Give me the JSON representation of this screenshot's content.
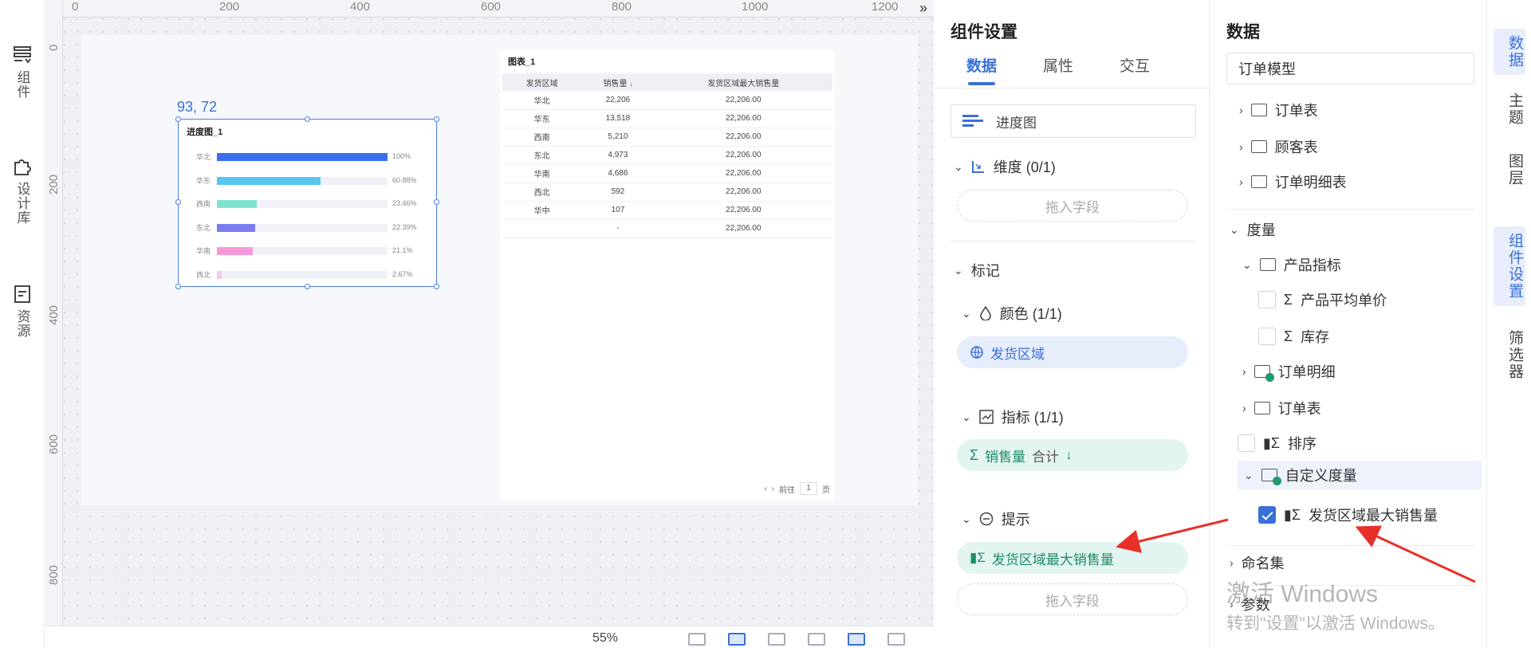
{
  "left_rail": {
    "items": [
      {
        "label": "组件"
      },
      {
        "label": "设计库"
      },
      {
        "label": "资源"
      }
    ]
  },
  "canvas": {
    "ruler_top_ticks": [
      "0",
      "200",
      "400",
      "600",
      "800",
      "1000",
      "1200"
    ],
    "ruler_left_ticks": [
      "0",
      "200",
      "400",
      "600",
      "800"
    ],
    "widget_coords": "93, 72",
    "zoom": "55%",
    "progress_widget": {
      "title": "进度图_1",
      "rows": [
        {
          "category": "华北",
          "percent_label": "100%",
          "fraction": 1.0,
          "color": "#3a6ff0"
        },
        {
          "category": "华东",
          "percent_label": "60.88%",
          "fraction": 0.6088,
          "color": "#58c6ef"
        },
        {
          "category": "西南",
          "percent_label": "23.46%",
          "fraction": 0.2346,
          "color": "#7de3cf"
        },
        {
          "category": "东北",
          "percent_label": "22.39%",
          "fraction": 0.2239,
          "color": "#7b7cf0"
        },
        {
          "category": "华南",
          "percent_label": "21.1%",
          "fraction": 0.211,
          "color": "#f59ad8"
        },
        {
          "category": "西北",
          "percent_label": "2.67%",
          "fraction": 0.0267,
          "color": "#f7c9e8"
        }
      ]
    },
    "table_widget": {
      "title": "图表_1",
      "columns": [
        "发货区域",
        "销售量",
        "发货区域最大销售量"
      ],
      "sort_marker": "↓",
      "rows": [
        [
          "华北",
          "22,206",
          "22,206.00"
        ],
        [
          "华东",
          "13,518",
          "22,206.00"
        ],
        [
          "西南",
          "5,210",
          "22,206.00"
        ],
        [
          "东北",
          "4,973",
          "22,206.00"
        ],
        [
          "华南",
          "4,686",
          "22,206.00"
        ],
        [
          "西北",
          "592",
          "22,206.00"
        ],
        [
          "华中",
          "107",
          "22,206.00"
        ],
        [
          "",
          "-",
          "22,206.00"
        ]
      ],
      "pager": {
        "prev": "‹",
        "next": "›",
        "goto_label": "前往",
        "page": "1",
        "page_suffix": "页"
      }
    }
  },
  "settings": {
    "title": "组件设置",
    "tabs": [
      {
        "label": "数据",
        "active": true
      },
      {
        "label": "属性",
        "active": false
      },
      {
        "label": "交互",
        "active": false
      }
    ],
    "chart_type": "进度图",
    "dimension": {
      "label": "维度 (0/1)",
      "drop_placeholder": "拖入字段"
    },
    "marks": {
      "label": "标记"
    },
    "color": {
      "label": "颜色 (1/1)",
      "field": "发货区域"
    },
    "metric": {
      "label": "指标 (1/1)",
      "field": "销售量",
      "agg": "合计",
      "sort": "↓"
    },
    "tooltip": {
      "label": "提示",
      "field": "发货区域最大销售量",
      "drop_placeholder": "拖入字段"
    }
  },
  "data_panel": {
    "title": "数据",
    "model": "订单模型",
    "tables": [
      "订单表",
      "顾客表",
      "订单明细表"
    ],
    "measure_label": "度量",
    "product_folder": "产品指标",
    "product_items": [
      "产品平均单价",
      "库存"
    ],
    "order_detail": "订单明细",
    "order_table": "订单表",
    "sort_item": "排序",
    "custom_folder": "自定义度量",
    "custom_item": "发货区域最大销售量",
    "named_set": "命名集",
    "params": "参数"
  },
  "right_rail": {
    "tabs": [
      {
        "label": "数据",
        "active": true
      },
      {
        "label": "主题",
        "active": false
      },
      {
        "label": "图层",
        "active": false
      },
      {
        "label": "组件设置",
        "active": true
      },
      {
        "label": "筛选器",
        "active": false
      }
    ]
  },
  "watermark": {
    "line1": "激活 Windows",
    "line2": "转到\"设置\"以激活 Windows。"
  },
  "colors": {
    "accent": "#3a6fd8",
    "pill_blue": "#e6edfb",
    "pill_green": "#e3f5f1",
    "annotation": "#e8302a"
  }
}
